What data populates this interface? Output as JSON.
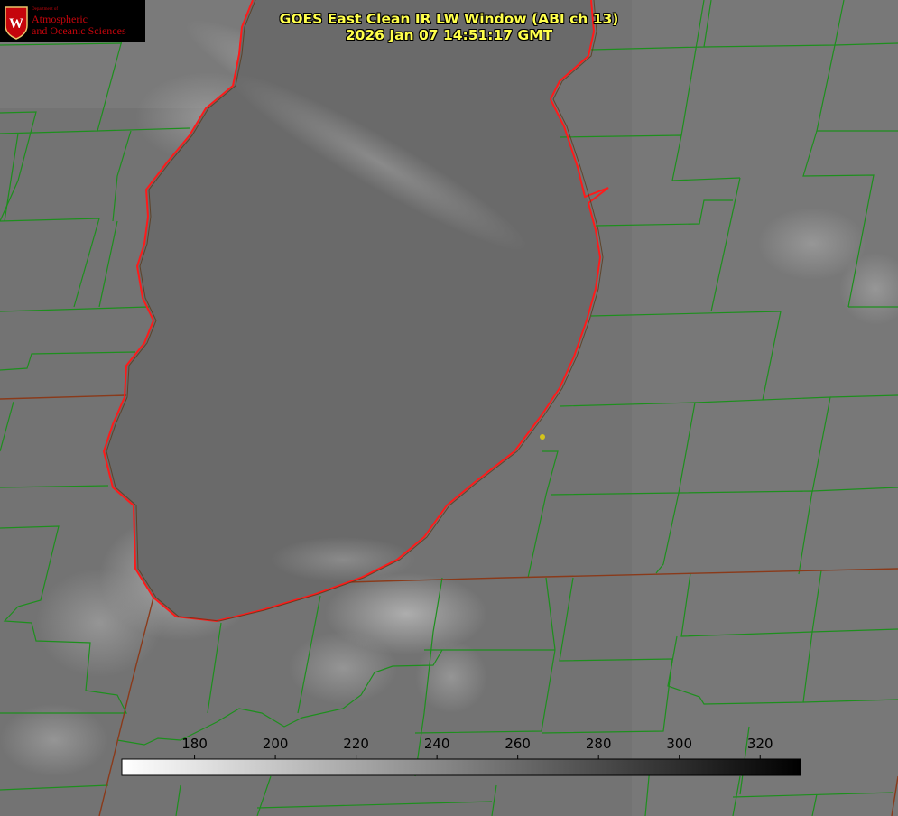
{
  "map": {
    "title_line1": "GOES East Clean IR LW Window (ABI ch 13)",
    "title_line2": "2026 Jan 07 14:51:17 GMT",
    "logo": {
      "department": "Department of",
      "line1": "Atmospheric",
      "line2": "and Oceanic Sciences"
    },
    "colorbar": {
      "ticks": [
        "180",
        "200",
        "220",
        "240",
        "260",
        "280",
        "300",
        "320"
      ],
      "min_value": 162,
      "max_value": 330,
      "ramp": "white to black"
    },
    "colors": {
      "background_gray": "#777777",
      "lake_gray": "#6b6b6b",
      "county_lines": "#1d8f1d",
      "state_lines": "#8a3a1a",
      "shoreline": "#ff1a1a",
      "title_text": "#ffff4c",
      "marker": "#d4c41a"
    }
  }
}
